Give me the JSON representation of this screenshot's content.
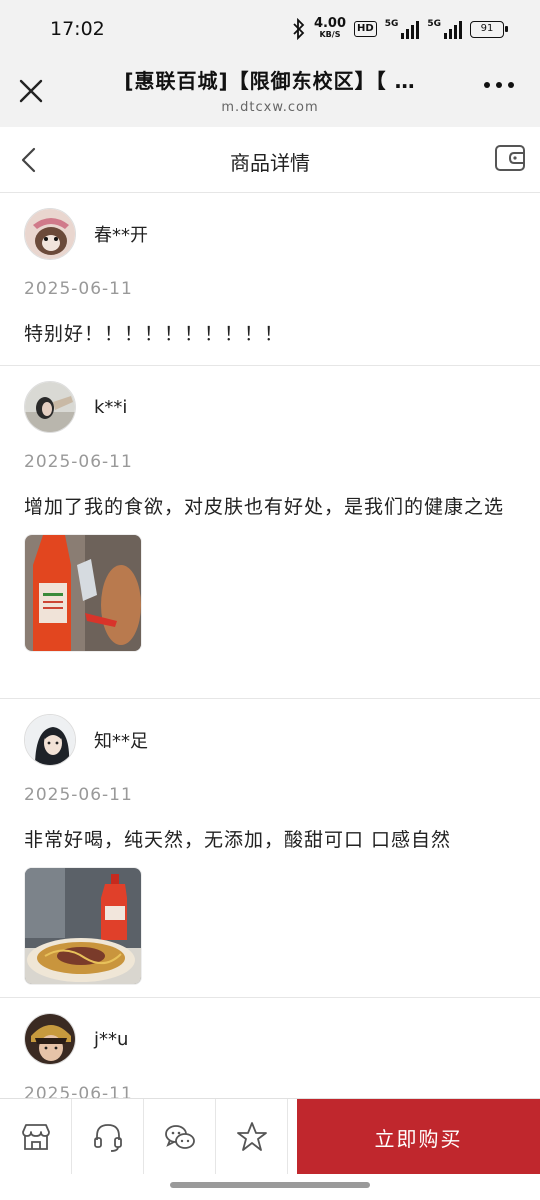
{
  "status_bar": {
    "time": "17:02",
    "net_speed_value": "4.00",
    "net_speed_unit": "KB/S",
    "hd_badge": "HD",
    "signal1_label": "5G",
    "signal2_label": "5G",
    "battery": "91"
  },
  "browser": {
    "title": "[惠联百城]【限御东校区】【 …",
    "url": "m.dtcxw.com"
  },
  "nav": {
    "title": "商品详情"
  },
  "reviews": [
    {
      "username": "春**开",
      "date": "2025-06-11",
      "text": "特别好！！！！！！！！！！"
    },
    {
      "username": "k**i",
      "date": "2025-06-11",
      "text": "增加了我的食欲，对皮肤也有好处，是我们的健康之选"
    },
    {
      "username": "知**足",
      "date": "2025-06-11",
      "text": "非常好喝，纯天然，无添加，酸甜可口 口感自然"
    },
    {
      "username": "j**u",
      "date": "2025-06-11",
      "text": ""
    }
  ],
  "bottom_bar": {
    "buy_label": "立即购买"
  },
  "colors": {
    "accent": "#c0272d",
    "header_bg": "#f2f2f2",
    "date_text": "#999999"
  }
}
